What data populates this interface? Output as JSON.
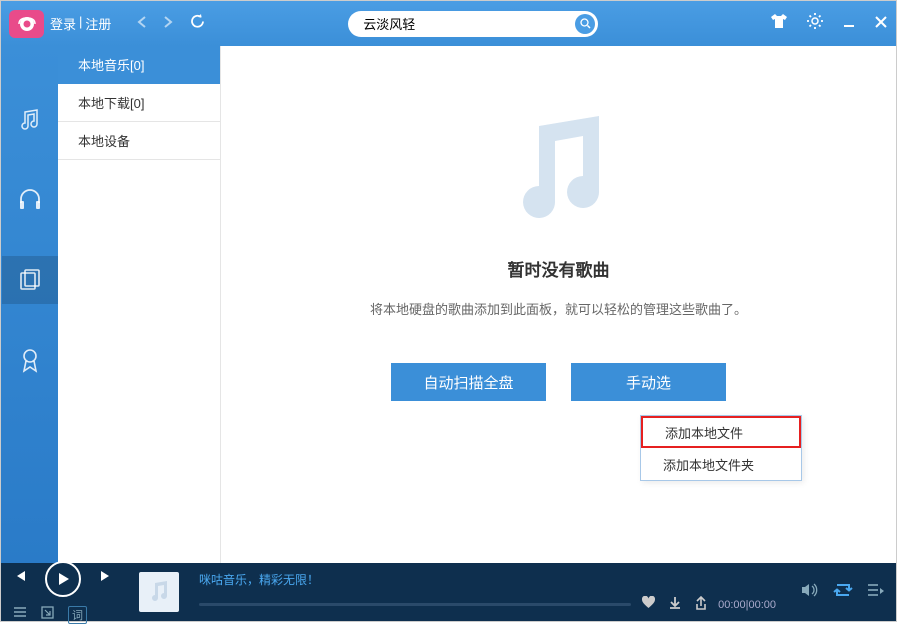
{
  "header": {
    "login": "登录",
    "register": "注册",
    "search_value": "云淡风轻"
  },
  "sidebar": {
    "items": [
      {
        "id": "music",
        "active": false
      },
      {
        "id": "headphones",
        "active": false
      },
      {
        "id": "library",
        "active": true
      },
      {
        "id": "badge",
        "active": false
      }
    ]
  },
  "subnav": {
    "items": [
      {
        "label": "本地音乐[0]",
        "active": true
      },
      {
        "label": "本地下载[0]",
        "active": false
      },
      {
        "label": "本地设备",
        "active": false
      }
    ]
  },
  "main": {
    "empty_title": "暂时没有歌曲",
    "empty_desc": "将本地硬盘的歌曲添加到此面板，就可以轻松的管理这些歌曲了。",
    "auto_scan": "自动扫描全盘",
    "manual_select": "手动选"
  },
  "dropdown": {
    "items": [
      {
        "label": "添加本地文件",
        "highlighted": true
      },
      {
        "label": "添加本地文件夹",
        "highlighted": false
      }
    ]
  },
  "player": {
    "text": "咪咕音乐，精彩无限！",
    "time_current": "00:00",
    "time_total": "00:00",
    "lyric_label": "词"
  }
}
